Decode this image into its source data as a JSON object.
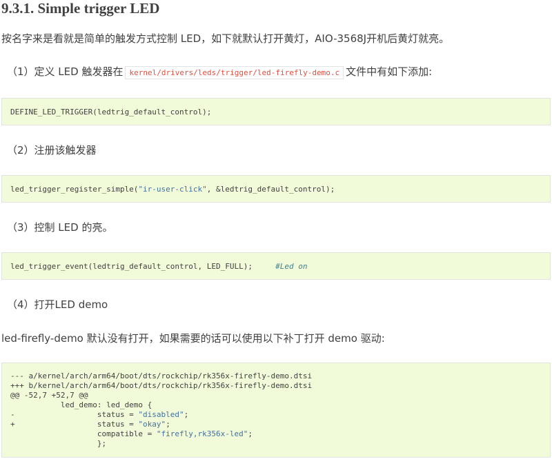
{
  "section": {
    "title": "9.3.1. Simple trigger LED"
  },
  "intro": "按名字来是看就是简单的触发方式控制 LED，如下就默认打开黄灯，AIO-3568J开机后黄灯就亮。",
  "step1": {
    "prefix": "（1）定义 LED 触发器在",
    "path": "kernel/drivers/leds/trigger/led-firefly-demo.c",
    "suffix": "文件中有如下添加:"
  },
  "code1": "DEFINE_LED_TRIGGER(ledtrig_default_control);",
  "step2": "（2）注册该触发器",
  "code2": {
    "func": "led_trigger_register_simple(",
    "str": "\"ir-user-click\"",
    "rest": ", &ledtrig_default_control);"
  },
  "step3": "（3）控制 LED 的亮。",
  "code3": {
    "stmt": "led_trigger_event(ledtrig_default_control, LED_FULL);     ",
    "comment": "#Led on"
  },
  "step4": "（4）打开LED demo",
  "para2": "led-firefly-demo 默认没有打开，如果需要的话可以使用以下补丁打开 demo 驱动:",
  "patch": {
    "line1": "--- a/kernel/arch/arm64/boot/dts/rockchip/rk356x-firefly-demo.dtsi",
    "line2": "+++ b/kernel/arch/arm64/boot/dts/rockchip/rk356x-firefly-demo.dtsi",
    "line3": "@@ -52,7 +52,7 @@",
    "line4": "           led_demo: led_demo {",
    "line5_pre": "-                  status = ",
    "line5_str": "\"disabled\"",
    "line5_end": ";",
    "line6_pre": "+                  status = ",
    "line6_str": "\"okay\"",
    "line6_end": ";",
    "line7_pre": "                   compatible = ",
    "line7_str": "\"firefly,rk356x-led\"",
    "line7_end": ";",
    "line8": "                   };"
  }
}
